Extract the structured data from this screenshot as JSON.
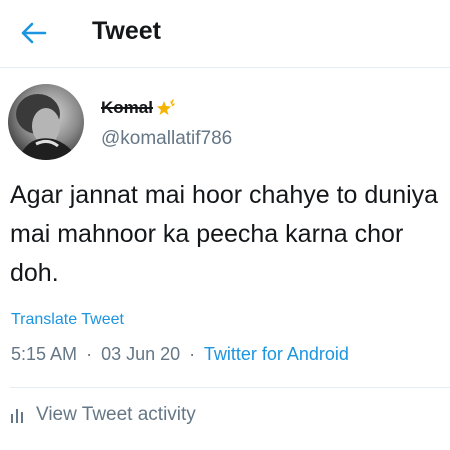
{
  "header": {
    "back_icon": "arrow-left-icon",
    "title": "Tweet"
  },
  "author": {
    "name": "Komal",
    "name_emoji": "star-emoji-icon",
    "handle": "@komallatif786"
  },
  "tweet": {
    "text": "Agar jannat mai hoor chahye to duniya mai mahnoor ka peecha karna chor doh.",
    "translate_label": "Translate Tweet",
    "time": "5:15 AM",
    "separator": "·",
    "date": "03 Jun 20",
    "source": "Twitter for Android"
  },
  "activity": {
    "icon": "bar-chart-icon",
    "label": "View Tweet activity"
  },
  "colors": {
    "accent": "#1b95e0",
    "muted": "#657786",
    "text": "#14171a",
    "divider": "#e6ecf0"
  }
}
